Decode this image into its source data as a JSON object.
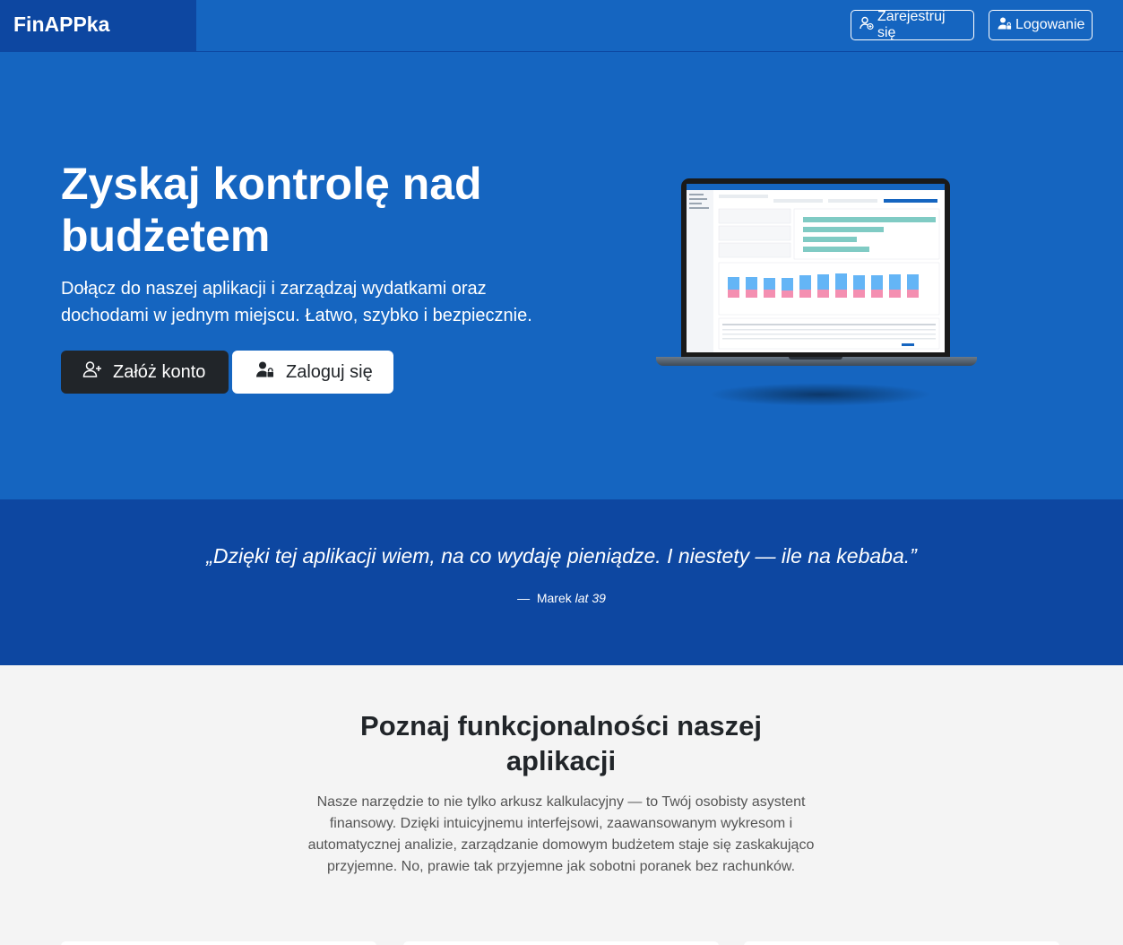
{
  "navbar": {
    "brand": "FinAPPka",
    "register_label": "Zarejestruj się",
    "login_label": "Logowanie"
  },
  "hero": {
    "title": "Zyskaj kontrolę nad budżetem",
    "subtitle": "Dołącz do naszej aplikacji i zarządzaj wydatkami oraz dochodami w jednym miejscu. Łatwo, szybko i bezpiecznie.",
    "create_account_label": "Załóż konto",
    "login_label": "Zaloguj się"
  },
  "quote": {
    "text": "„Dzięki tej aplikacji wiem, na co wydaję pieniądze. I niestety — ile na kebaba.”",
    "dash": "—",
    "author": "Marek",
    "age": "lat 39"
  },
  "features": {
    "title": "Poznaj funkcjonalności naszej aplikacji",
    "description": "Nasze narzędzie to nie tylko arkusz kalkulacyjny — to Twój osobisty asystent finansowy. Dzięki intuicyjnemu interfejsowi, zaawansowanym wykresom i automatycznej analizie, zarządzanie domowym budżetem staje się zaskakująco przyjemne. No, prawie tak przyjemne jak sobotni poranek bez rachunków."
  },
  "colors": {
    "primary": "#1565c0",
    "primary_dark": "#0d47a1",
    "dark_button": "#212529",
    "chart_teal": "#80cbc4",
    "chart_blue": "#64b5f6",
    "chart_pink": "#f48fb1"
  }
}
